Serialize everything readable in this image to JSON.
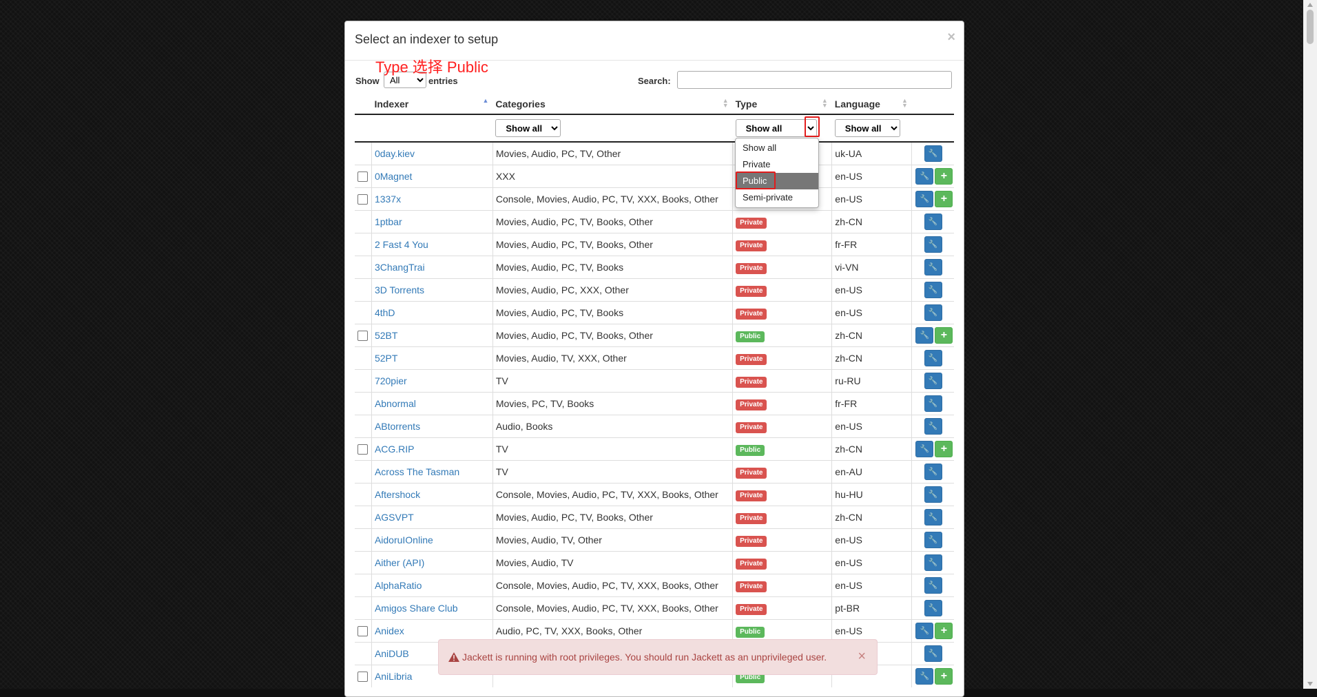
{
  "modal": {
    "title": "Select an indexer to setup",
    "close_glyph": "×"
  },
  "controls": {
    "show_label": "Show",
    "entries_value": "All",
    "entries_label": "entries",
    "search_label": "Search:",
    "search_value": ""
  },
  "annotation": "Type 选择 Public",
  "columns": {
    "indexer": "Indexer",
    "categories": "Categories",
    "type": "Type",
    "language": "Language"
  },
  "filters": {
    "categories": "Show all",
    "type": "Show all",
    "language": "Show all"
  },
  "type_dropdown": {
    "options": [
      "Show all",
      "Private",
      "Public",
      "Semi-private"
    ],
    "selected": "Public"
  },
  "badges": {
    "private": "Private",
    "public": "Public"
  },
  "rows": [
    {
      "name": "0day.kiev",
      "categories": "Movies, Audio, PC, TV, Other",
      "type": "private",
      "language": "uk-UA",
      "checkbox": false
    },
    {
      "name": "0Magnet",
      "categories": "XXX",
      "type": "public",
      "language": "en-US",
      "checkbox": true
    },
    {
      "name": "1337x",
      "categories": "Console, Movies, Audio, PC, TV, XXX, Books, Other",
      "type": "public",
      "language": "en-US",
      "checkbox": true
    },
    {
      "name": "1ptbar",
      "categories": "Movies, Audio, PC, TV, Books, Other",
      "type": "private",
      "language": "zh-CN",
      "checkbox": false
    },
    {
      "name": "2 Fast 4 You",
      "categories": "Movies, Audio, PC, TV, Books, Other",
      "type": "private",
      "language": "fr-FR",
      "checkbox": false
    },
    {
      "name": "3ChangTrai",
      "categories": "Movies, Audio, PC, TV, Books",
      "type": "private",
      "language": "vi-VN",
      "checkbox": false
    },
    {
      "name": "3D Torrents",
      "categories": "Movies, Audio, PC, XXX, Other",
      "type": "private",
      "language": "en-US",
      "checkbox": false
    },
    {
      "name": "4thD",
      "categories": "Movies, Audio, PC, TV, Books",
      "type": "private",
      "language": "en-US",
      "checkbox": false
    },
    {
      "name": "52BT",
      "categories": "Movies, Audio, PC, TV, Books, Other",
      "type": "public",
      "language": "zh-CN",
      "checkbox": true
    },
    {
      "name": "52PT",
      "categories": "Movies, Audio, TV, XXX, Other",
      "type": "private",
      "language": "zh-CN",
      "checkbox": false
    },
    {
      "name": "720pier",
      "categories": "TV",
      "type": "private",
      "language": "ru-RU",
      "checkbox": false
    },
    {
      "name": "Abnormal",
      "categories": "Movies, PC, TV, Books",
      "type": "private",
      "language": "fr-FR",
      "checkbox": false
    },
    {
      "name": "ABtorrents",
      "categories": "Audio, Books",
      "type": "private",
      "language": "en-US",
      "checkbox": false
    },
    {
      "name": "ACG.RIP",
      "categories": "TV",
      "type": "public",
      "language": "zh-CN",
      "checkbox": true
    },
    {
      "name": "Across The Tasman",
      "categories": "TV",
      "type": "private",
      "language": "en-AU",
      "checkbox": false
    },
    {
      "name": "Aftershock",
      "categories": "Console, Movies, Audio, PC, TV, XXX, Books, Other",
      "type": "private",
      "language": "hu-HU",
      "checkbox": false
    },
    {
      "name": "AGSVPT",
      "categories": "Movies, Audio, PC, TV, Books, Other",
      "type": "private",
      "language": "zh-CN",
      "checkbox": false
    },
    {
      "name": "AidoruIOnline",
      "categories": "Movies, Audio, TV, Other",
      "type": "private",
      "language": "en-US",
      "checkbox": false
    },
    {
      "name": "Aither (API)",
      "categories": "Movies, Audio, TV",
      "type": "private",
      "language": "en-US",
      "checkbox": false
    },
    {
      "name": "AlphaRatio",
      "categories": "Console, Movies, Audio, PC, TV, XXX, Books, Other",
      "type": "private",
      "language": "en-US",
      "checkbox": false
    },
    {
      "name": "Amigos Share Club",
      "categories": "Console, Movies, Audio, PC, TV, XXX, Books, Other",
      "type": "private",
      "language": "pt-BR",
      "checkbox": false
    },
    {
      "name": "Anidex",
      "categories": "Audio, PC, TV, XXX, Books, Other",
      "type": "public",
      "language": "en-US",
      "checkbox": true
    },
    {
      "name": "AniDUB",
      "categories": "",
      "type": "",
      "language": "",
      "checkbox": false
    },
    {
      "name": "AniLibria",
      "categories": "",
      "type": "public",
      "language": "",
      "checkbox": true
    }
  ],
  "toast": {
    "message": "Jackett is running with root privileges. You should run Jackett as an unprivileged user.",
    "close_glyph": "×"
  },
  "colors": {
    "link": "#337ab7",
    "private_badge": "#d9534f",
    "public_badge": "#5cb85c",
    "annotation": "#ff1f1f",
    "highlight_box": "#e21b1b"
  }
}
